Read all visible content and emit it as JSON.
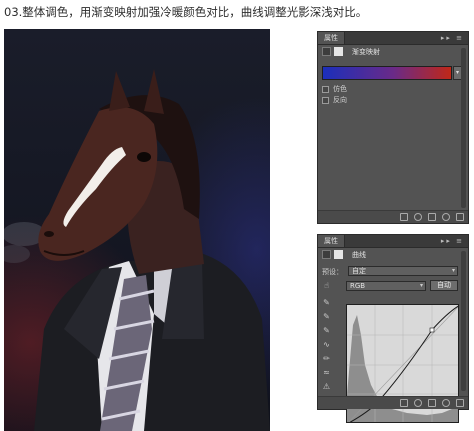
{
  "caption": "03.整体调色，用渐变映射加强冷暖颜色对比，曲线调整光影深浅对比。",
  "photo": {
    "description_icon": "horse-head-portrait"
  },
  "panel1": {
    "tab": "属性",
    "header_controls": "▸▸ ≡",
    "title": "渐变映射",
    "dropdown_glyph": "▾",
    "options": [
      {
        "label": "仿色"
      },
      {
        "label": "反向"
      }
    ],
    "gradient_colors": [
      "#1b2fbb",
      "#c02818"
    ]
  },
  "panel2": {
    "tab": "属性",
    "header_controls": "▸▸ ≡",
    "title": "曲线",
    "preset_label": "预设：",
    "preset_value": "自定",
    "channel_value": "RGB",
    "auto_button": "自动",
    "dropdown_glyph": "▾"
  }
}
